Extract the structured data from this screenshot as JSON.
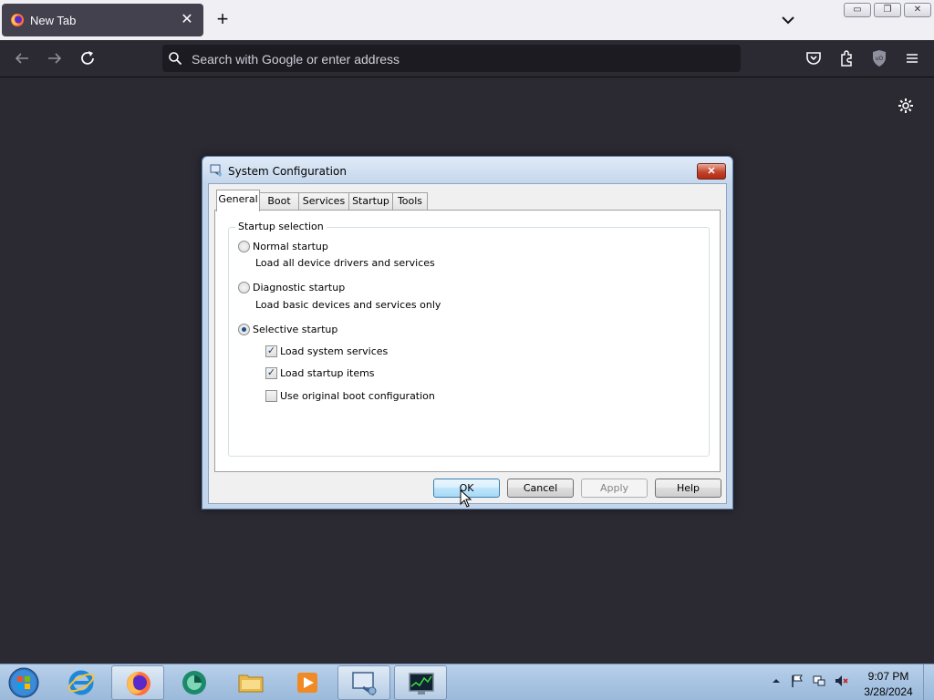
{
  "browser": {
    "tab_title": "New Tab",
    "tab_close": "✕",
    "new_tab": "+",
    "address_placeholder": "Search with Google or enter address",
    "window_controls": {
      "minimize": "▭",
      "maximize": "❐",
      "close": "✕"
    },
    "icons": [
      "firefox-icon",
      "back-arrow-icon",
      "forward-arrow-icon",
      "reload-icon",
      "search-icon",
      "pocket-icon",
      "extensions-icon",
      "ublock-icon",
      "menu-icon",
      "settings-gear-icon",
      "chevron-down-icon"
    ]
  },
  "dialog": {
    "title": "System Configuration",
    "close_label": "✕",
    "tabs": [
      {
        "label": "General",
        "active": true
      },
      {
        "label": "Boot",
        "active": false
      },
      {
        "label": "Services",
        "active": false
      },
      {
        "label": "Startup",
        "active": false
      },
      {
        "label": "Tools",
        "active": false
      }
    ],
    "group_title": "Startup selection",
    "options": [
      {
        "label": "Normal startup",
        "description": "Load all device drivers and services",
        "selected": false
      },
      {
        "label": "Diagnostic startup",
        "description": "Load basic devices and services only",
        "selected": false
      },
      {
        "label": "Selective startup",
        "selected": true
      }
    ],
    "checkboxes": [
      {
        "label": "Load system services",
        "checked": true
      },
      {
        "label": "Load startup items",
        "checked": true
      },
      {
        "label": "Use original boot configuration",
        "checked": false
      }
    ],
    "buttons": {
      "ok": "OK",
      "cancel": "Cancel",
      "apply": "Apply",
      "help": "Help"
    }
  },
  "taskbar": {
    "time": "9:07 PM",
    "date": "3/28/2024",
    "pinned": [
      "internet-explorer-icon",
      "firefox-icon",
      "app-icon",
      "file-explorer-icon",
      "media-player-icon",
      "system-configuration-icon",
      "task-manager-icon"
    ]
  }
}
